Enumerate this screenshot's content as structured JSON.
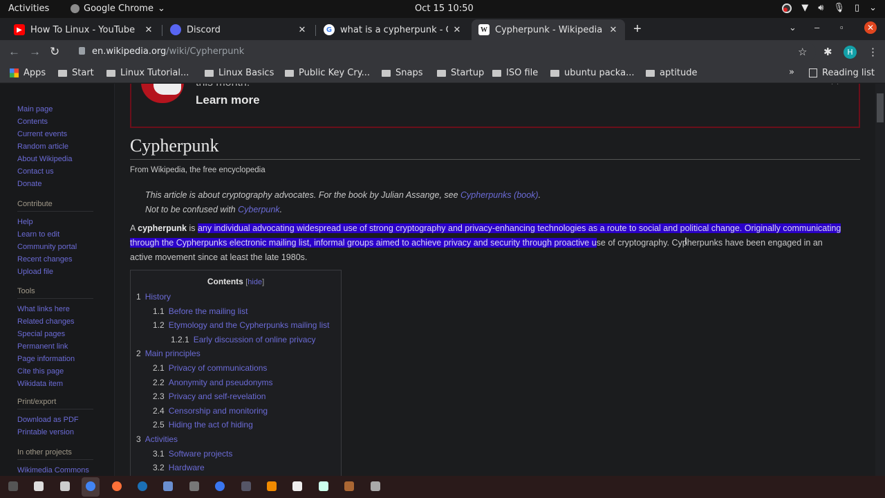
{
  "system_bar": {
    "activities": "Activities",
    "app_name": "Google Chrome",
    "datetime": "Oct 15  10:50"
  },
  "browser": {
    "tabs": [
      {
        "title": "How To Linux - YouTube",
        "favicon": "youtube-icon",
        "active": false
      },
      {
        "title": "Discord",
        "favicon": "discord-icon",
        "active": false
      },
      {
        "title": "what is a cypherpunk - Go",
        "favicon": "google-icon",
        "active": false
      },
      {
        "title": "Cypherpunk - Wikipedia",
        "favicon": "wikipedia-icon",
        "active": true
      }
    ],
    "new_tab": "+",
    "url_host": "en.wikipedia.org",
    "url_path": "/wiki/Cypherpunk",
    "profile_initial": "H",
    "bookmarks": [
      "Apps",
      "Start",
      "Linux Tutorial...",
      "Linux Basics",
      "Public Key Cry...",
      "Snaps",
      "Startup",
      "ISO file",
      "ubuntu packa...",
      "aptitude"
    ],
    "bookmarks_more": "»",
    "reading_list": "Reading list"
  },
  "sidebar": {
    "nav": [
      "Main page",
      "Contents",
      "Current events",
      "Random article",
      "About Wikipedia",
      "Contact us",
      "Donate"
    ],
    "contribute": {
      "heading": "Contribute",
      "items": [
        "Help",
        "Learn to edit",
        "Community portal",
        "Recent changes",
        "Upload file"
      ]
    },
    "tools": {
      "heading": "Tools",
      "items": [
        "What links here",
        "Related changes",
        "Special pages",
        "Permanent link",
        "Page information",
        "Cite this page",
        "Wikidata item"
      ]
    },
    "print": {
      "heading": "Print/export",
      "items": [
        "Download as PDF",
        "Printable version"
      ]
    },
    "other": {
      "heading": "In other projects",
      "items": [
        "Wikimedia Commons"
      ]
    }
  },
  "banner": {
    "tagline": "this month!",
    "learn_more": "Learn more",
    "close": "✕"
  },
  "article": {
    "title": "Cypherpunk",
    "subtitle": "From Wikipedia, the free encyclopedia",
    "hatnote1_text": "This article is about cryptography advocates. For the book by Julian Assange, see ",
    "hatnote1_link": "Cypherpunks (book)",
    "hatnote1_end": ".",
    "hatnote2_text": "Not to be confused with ",
    "hatnote2_link": "Cyberpunk",
    "hatnote2_end": ".",
    "lead_a": "A ",
    "lead_bold": "cypherpunk",
    "lead_b": " is ",
    "lead_selected": "any individual advocating widespread use of strong cryptography and privacy-enhancing technologies as a route to social and political change. Originally communicating through the Cypherpunks electronic mailing list, informal groups aimed to achieve privacy and security through proactive u",
    "lead_rest": "se of cryptography. Cypherpunks have been engaged in an active movement since at least the late 1980s."
  },
  "toc": {
    "title": "Contents",
    "hide": "hide",
    "items": [
      {
        "num": "1",
        "label": "History",
        "level": 1
      },
      {
        "num": "1.1",
        "label": "Before the mailing list",
        "level": 2
      },
      {
        "num": "1.2",
        "label": "Etymology and the Cypherpunks mailing list",
        "level": 2
      },
      {
        "num": "1.2.1",
        "label": "Early discussion of online privacy",
        "level": 3
      },
      {
        "num": "2",
        "label": "Main principles",
        "level": 1
      },
      {
        "num": "2.1",
        "label": "Privacy of communications",
        "level": 2
      },
      {
        "num": "2.2",
        "label": "Anonymity and pseudonyms",
        "level": 2
      },
      {
        "num": "2.3",
        "label": "Privacy and self-revelation",
        "level": 2
      },
      {
        "num": "2.4",
        "label": "Censorship and monitoring",
        "level": 2
      },
      {
        "num": "2.5",
        "label": "Hiding the act of hiding",
        "level": 2
      },
      {
        "num": "3",
        "label": "Activities",
        "level": 1
      },
      {
        "num": "3.1",
        "label": "Software projects",
        "level": 2
      },
      {
        "num": "3.2",
        "label": "Hardware",
        "level": 2
      }
    ]
  },
  "dock": {
    "apps": [
      "terminal",
      "files",
      "disks",
      "chrome",
      "firefox",
      "steam",
      "remote",
      "screenshot",
      "signal",
      "terminal-alt",
      "vlc",
      "github-desktop",
      "vscodium",
      "photo-app",
      "archive"
    ],
    "active": "chrome"
  },
  "colors": {
    "selection": "#2b00c9",
    "link": "#6b6bd6",
    "banner_border": "#6b0f1a",
    "close_red": "#e0461f"
  }
}
